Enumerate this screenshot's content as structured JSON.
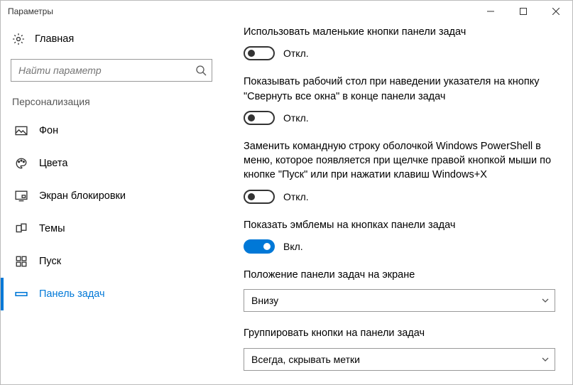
{
  "window": {
    "title": "Параметры"
  },
  "sidebar": {
    "home_label": "Главная",
    "search_placeholder": "Найти параметр",
    "section_header": "Персонализация",
    "items": [
      {
        "label": "Фон"
      },
      {
        "label": "Цвета"
      },
      {
        "label": "Экран блокировки"
      },
      {
        "label": "Темы"
      },
      {
        "label": "Пуск"
      },
      {
        "label": "Панель задач"
      }
    ]
  },
  "settings": {
    "small_buttons": {
      "label": "Использовать маленькие кнопки панели задач",
      "state": "Откл."
    },
    "peek_desktop": {
      "label": "Показывать рабочий стол при наведении указателя на кнопку \"Свернуть все окна\" в конце панели задач",
      "state": "Откл."
    },
    "powershell": {
      "label": "Заменить командную строку оболочкой Windows PowerShell в меню, которое появляется при щелчке правой кнопкой мыши по кнопке \"Пуск\" или при нажатии клавиш Windows+X",
      "state": "Откл."
    },
    "badges": {
      "label": "Показать эмблемы на кнопках панели задач",
      "state": "Вкл."
    },
    "position": {
      "label": "Положение панели задач на экране",
      "value": "Внизу"
    },
    "combine": {
      "label": "Группировать кнопки на панели задач",
      "value": "Всегда, скрывать метки"
    }
  }
}
